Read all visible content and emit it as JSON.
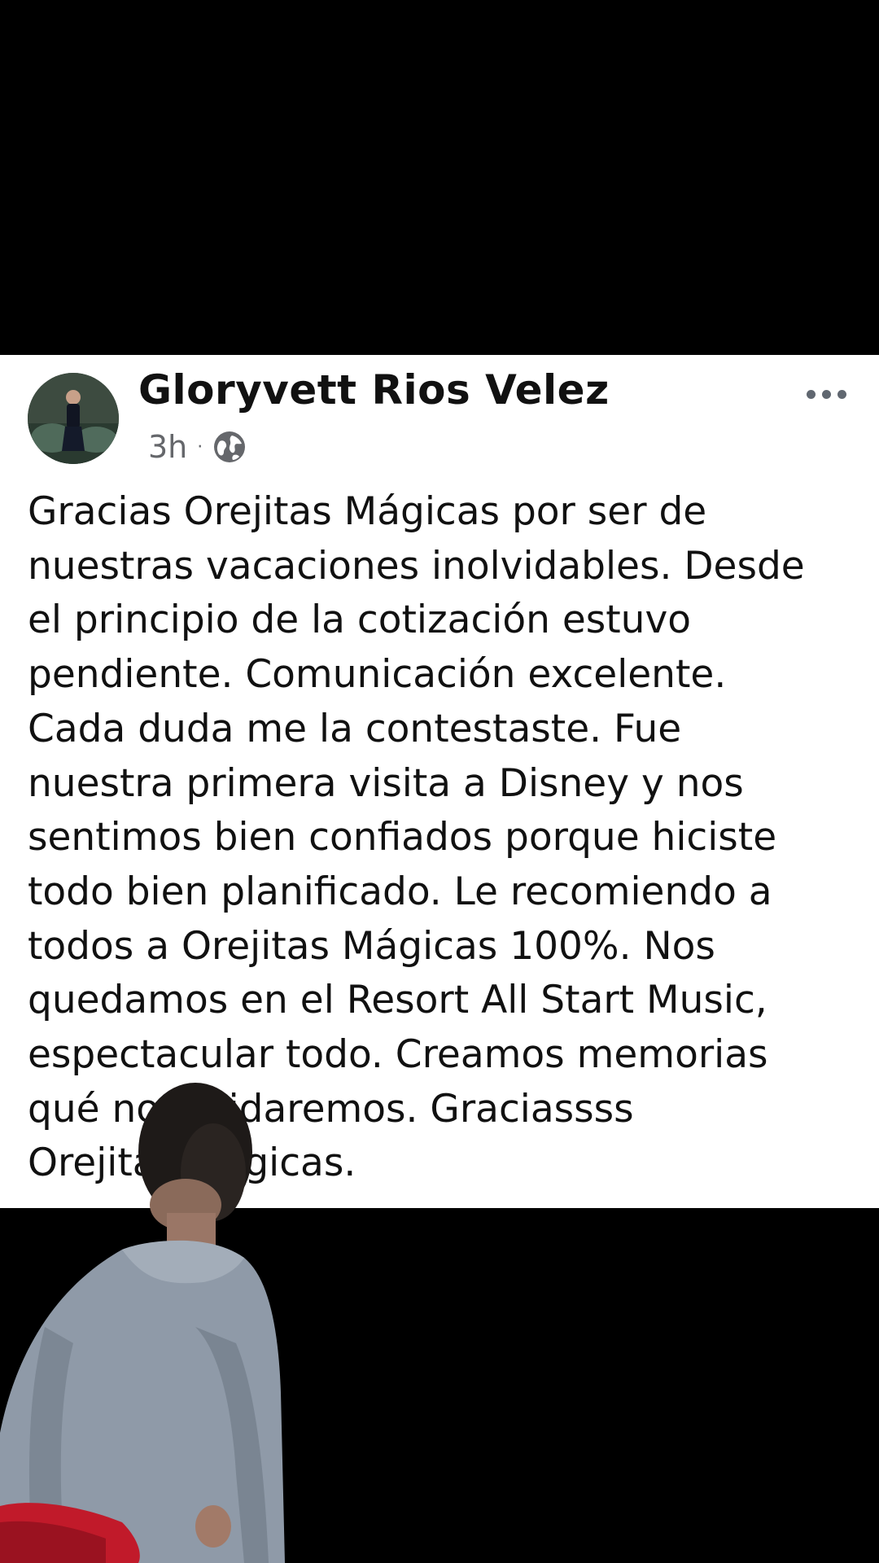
{
  "post": {
    "author_name": "Gloryvett Rios Velez",
    "time": "3h",
    "separator": "·",
    "privacy_icon": "globe-icon",
    "more_icon": "more-options-icon",
    "text": "Gracias Orejitas Mágicas por ser de\nnuestras vacaciones inolvidables. Desde\nel principio de la cotización estuvo\npendiente. Comunicación excelente.\nCada duda me la contestaste. Fue\nnuestra primera visita a Disney y nos\nsentimos bien confiados porque hiciste\ntodo bien planificado. Le recomiendo a\ntodos a Orejitas Mágicas 100%. Nos\nquedamos en el Resort All Start Music,\nespectacular todo. Creamos memorias\nqué no olvidaremos. Graciassss\nOrejitas Mágicas."
  },
  "colors": {
    "background": "#000000",
    "card": "#ffffff",
    "text": "#111111",
    "meta": "#65676b"
  }
}
